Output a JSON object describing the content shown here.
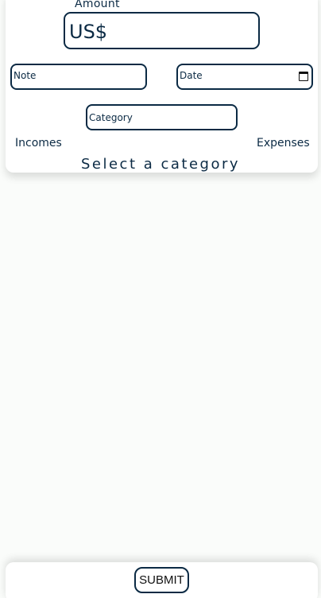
{
  "form": {
    "amount_label": "Amount",
    "amount_value": "US$",
    "note_placeholder": "Note",
    "date_placeholder": "Date",
    "category_placeholder": "Category",
    "incomes_label": "Incomes",
    "expenses_label": "Expenses",
    "select_prompt": "Select a category"
  },
  "footer": {
    "submit_label": "SUBMIT"
  },
  "icons": {
    "date": "calendar-icon"
  },
  "colors": {
    "accent": "#0b2a44",
    "background": "#fafcfa",
    "card": "#ffffff"
  }
}
